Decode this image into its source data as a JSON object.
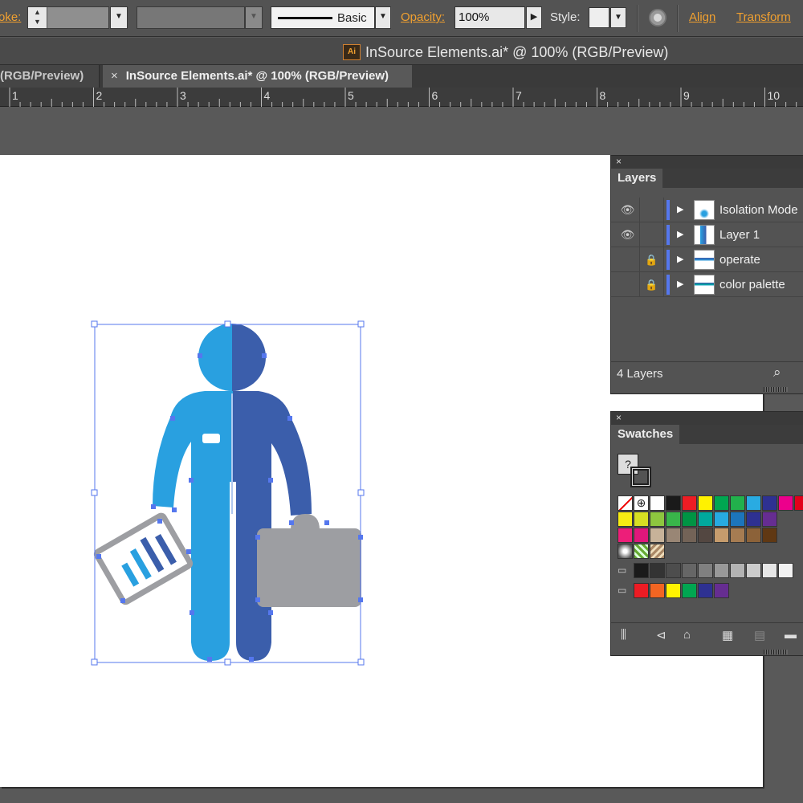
{
  "control_bar": {
    "stroke_label": "oke:",
    "brush_label": "Basic",
    "opacity_label": "Opacity:",
    "opacity_value": "100%",
    "style_label": "Style:",
    "align_label": "Align",
    "transform_label": "Transform"
  },
  "window": {
    "document_title": "InSource Elements.ai* @ 100% (RGB/Preview)",
    "app_icon": "Ai"
  },
  "tabs": [
    {
      "label": "(RGB/Preview)"
    },
    {
      "label": "InSource Elements.ai* @ 100% (RGB/Preview)",
      "close": "×"
    }
  ],
  "ruler": {
    "labels": [
      "1",
      "2",
      "3",
      "4",
      "5",
      "6",
      "7",
      "8",
      "9",
      "10"
    ]
  },
  "layers_panel": {
    "title": "Layers",
    "close": "×",
    "layers": [
      {
        "name": "Isolation Mode",
        "visible": true,
        "locked": false
      },
      {
        "name": "Layer 1",
        "visible": true,
        "locked": false
      },
      {
        "name": "operate",
        "visible": false,
        "locked": true
      },
      {
        "name": "color palette",
        "visible": false,
        "locked": true
      }
    ],
    "footer_count": "4 Layers"
  },
  "swatches_panel": {
    "title": "Swatches",
    "close": "×",
    "row1": [
      "#ffffff",
      "#1a1a1a",
      "#ed1c24",
      "#fff200",
      "#00a651",
      "#22b14c",
      "#29abe2",
      "#2e3192",
      "#ec008c",
      "#e2001a"
    ],
    "row2": [
      "#f7ec13",
      "#d7df23",
      "#8dc63f",
      "#39b54a",
      "#009444",
      "#00a99d",
      "#27aae1",
      "#1c75bc",
      "#2e3192",
      "#662d91"
    ],
    "row3": [
      "#ed1e79",
      "#e0177b",
      "#c7b299",
      "#998675",
      "#736357",
      "#534741",
      "#c69c6d",
      "#a67c52",
      "#8c6239",
      "#603813"
    ],
    "row5": [
      "#1a1a1a",
      "#333333",
      "#4d4d4d",
      "#666666",
      "#808080",
      "#999999",
      "#b3b3b3",
      "#cccccc",
      "#e6e6e6",
      "#f2f2f2"
    ],
    "row6": [
      "#ed1c24",
      "#f26522",
      "#fff200",
      "#00a651",
      "#2e3192",
      "#662d91"
    ]
  },
  "colors": {
    "figure_light": "#29a0e0",
    "figure_dark": "#3b5eab",
    "briefcase": "#9d9ea2",
    "selection": "#5577ee"
  }
}
